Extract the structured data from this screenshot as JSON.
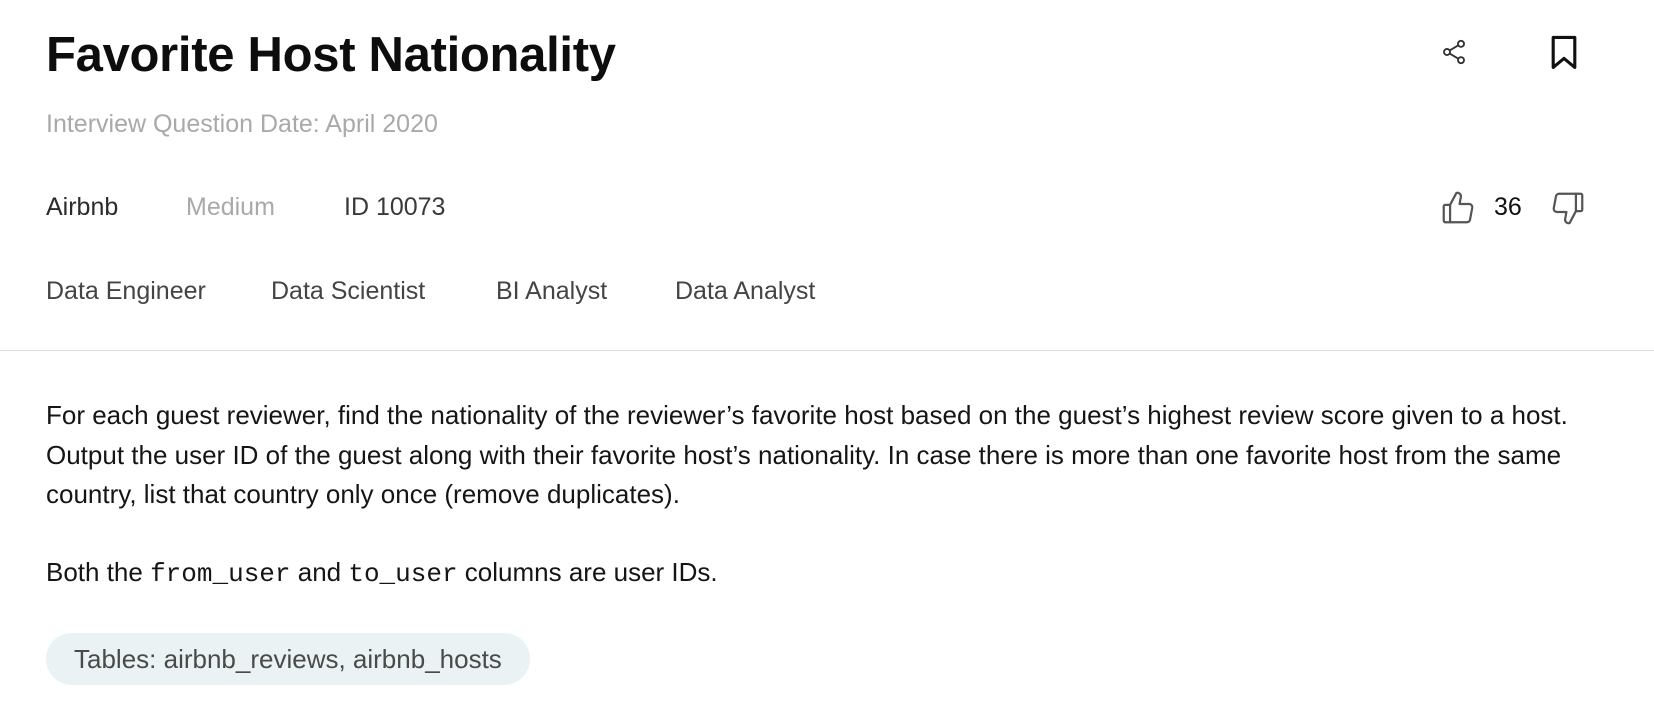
{
  "question": {
    "title": "Favorite Host Nationality",
    "date_label": "Interview Question Date: April 2020",
    "company": "Airbnb",
    "difficulty": "Medium",
    "id_label": "ID 10073",
    "votes": "36",
    "roles": [
      "Data Engineer",
      "Data Scientist",
      "BI Analyst",
      "Data Analyst"
    ],
    "description": "For each guest reviewer, find the nationality of the reviewer’s favorite host based on the guest’s highest review score given to a host. Output the user ID of the guest along with their favorite host’s nationality. In case there is more than one favorite host from the same country, list that country only once (remove duplicates).",
    "note": {
      "prefix": "Both the ",
      "code1": "from_user",
      "middle": " and ",
      "code2": "to_user",
      "suffix": " columns are user IDs."
    },
    "tables_label": "Tables: airbnb_reviews, airbnb_hosts"
  },
  "icons": {
    "share": "share-icon",
    "bookmark": "bookmark-icon",
    "thumbs_up": "thumbs-up-icon",
    "thumbs_down": "thumbs-down-icon"
  },
  "colors": {
    "title": "#0d0d0d",
    "muted": "#a9a9a9",
    "chip_background": "#eaf2f3",
    "divider": "#dcdcdc"
  }
}
